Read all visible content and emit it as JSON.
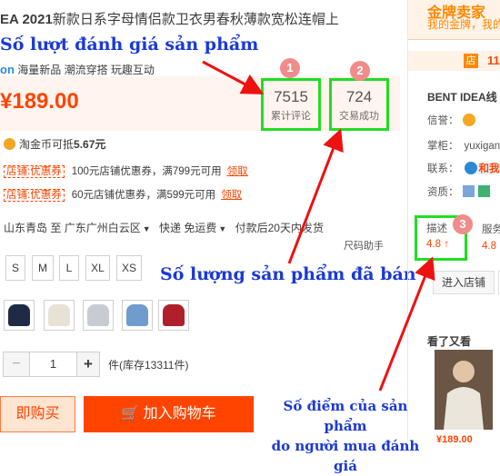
{
  "title": {
    "brand": "EA 2021",
    "text": "新款日系字母情侣款卫衣男春秋薄款宽松连帽上"
  },
  "annotations": {
    "reviews": "Số lượt đánh giá sản phẩm",
    "sold": "Số lượng sản phẩm đã bán",
    "rating_line1": "Số điểm của sản phẩm",
    "rating_line2": "do người mua đánh giá"
  },
  "subtitle": {
    "brand_suffix": "on",
    "text": "海量新品 潮流穿搭 玩趣互动"
  },
  "price": "¥189.00",
  "stats": {
    "reviews": {
      "badge": "1",
      "value": "7515",
      "label": "累计评论"
    },
    "sold": {
      "badge": "2",
      "value": "724",
      "label": "交易成功"
    }
  },
  "coin": {
    "text": "淘金币可抵",
    "amount": "5.67元"
  },
  "coupons": [
    {
      "tag": "店铺:优惠券",
      "text": "100元店铺优惠券，满799元可用",
      "action": "领取"
    },
    {
      "tag": "店铺:优惠券",
      "text": "60元店铺优惠券，满599元可用",
      "action": "领取"
    }
  ],
  "shipping": {
    "from": "山东青岛",
    "to_label": "至",
    "to": "广东广州白云区",
    "method": "快递 免运费",
    "delivery": "付款后20天内发货"
  },
  "size_helper": "尺码助手",
  "sizes": [
    "S",
    "M",
    "L",
    "XL",
    "XS"
  ],
  "swatches": [
    "#1f2a44",
    "#e8e2d6",
    "#c7ccd2",
    "#6f9ccc",
    "#b0202a"
  ],
  "quantity": {
    "minus": "−",
    "value": "1",
    "plus": "+",
    "stock": "件(库存13311件)"
  },
  "actions": {
    "buy_now": "即购买",
    "add_cart": "加入购物车"
  },
  "seller": {
    "gold_title": "金牌卖家",
    "gold_sub": "我的金牌，我的金",
    "store_icon": "店",
    "store_num": "11",
    "shop_name": "BENT IDEA线",
    "credit_label": "信誉：",
    "owner_label": "掌柜：",
    "owner": "yuxigan",
    "contact_label": "联系：",
    "contact_badge": "和我",
    "qual_label": "资质：",
    "rating_badge": "3",
    "rating_label": "描述",
    "rating_value": "4.8",
    "service_label": "服务",
    "service_value": "4.8",
    "enter_shop": "进入店铺",
    "see_more": "看了又看",
    "thumb_price": "¥189.00"
  },
  "colors": {
    "accent": "#ff4400",
    "highlight_box": "#22dd22",
    "annotation": "#1a39d8",
    "arrow": "#ee1111"
  }
}
